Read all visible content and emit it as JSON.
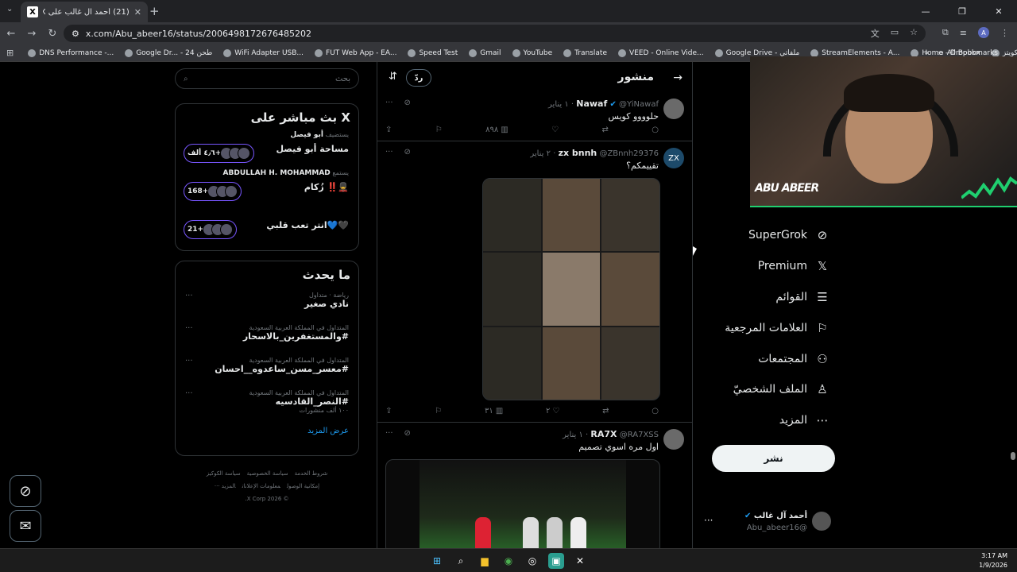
{
  "browser": {
    "tab_title": "(21) أحمد آل غالب على X: \"الي...",
    "tab_favicon": "X",
    "url": "x.com/Abu_abeer16/status/2006498172676485202",
    "bookmarks": [
      {
        "label": "DNS Performance -..."
      },
      {
        "label": "Google Dr... - طحن 24"
      },
      {
        "label": "WiFi Adapter USB..."
      },
      {
        "label": "FUT Web App - EA..."
      },
      {
        "label": "Speed Test"
      },
      {
        "label": "Gmail"
      },
      {
        "label": "YouTube"
      },
      {
        "label": "Translate"
      },
      {
        "label": "VEED - Online Vide..."
      },
      {
        "label": "Google Drive - ملفاتي"
      },
      {
        "label": "StreamElements - A..."
      },
      {
        "label": "Home - Dropbox"
      },
      {
        "label": "متجر الكويتز"
      }
    ],
    "all_bookmarks": "All Bookmarks",
    "profile_initial": "A"
  },
  "right": {
    "search_placeholder": "بحث",
    "live_title": "X بث مباشر على",
    "live": [
      {
        "host_label": "يستضيف",
        "host": "أبو فيصل",
        "name": "مساحة أبو فيصل",
        "count": "٤٫٦ ألف+"
      },
      {
        "host_label": "يستمع",
        "host": "ABDULLAH H. MOHAMMAD",
        "name": "💂‼️ زُكام",
        "count": "168+"
      },
      {
        "host_label": "",
        "host": "",
        "name": "🖤💙انتر تعب قلبي",
        "count": "21+"
      }
    ],
    "trends_title": "ما يحدث",
    "trends": [
      {
        "meta": "رياضة · متداول",
        "name": "نادي صغير",
        "extra": ""
      },
      {
        "meta": "المتداول في المملكة العربية السعودية",
        "name": "#والمستغفرين_بالاسحار",
        "extra": ""
      },
      {
        "meta": "المتداول في المملكة العربية السعودية",
        "name": "#معسر_مسن_ساعدوه__احسان",
        "extra": ""
      },
      {
        "meta": "المتداول في المملكة العربية السعودية",
        "name": "#النصر_القادسيه",
        "extra": "١٠٠ ألف منشورات"
      }
    ],
    "show_more": "عرض المزيد",
    "footer_line1": [
      "شروط الخدمة",
      "سياسة الخصوصية",
      "سياسة الكوكيز"
    ],
    "footer_line2": [
      "إمكانية الوصول",
      "معلومات الإعلانات",
      "المزيد ···"
    ],
    "footer_copy": "© 2026 X Corp."
  },
  "main": {
    "title": "منشور",
    "reply_label": "ردّ",
    "tweets": [
      {
        "avatar": "",
        "name": "Nawaf",
        "verified": true,
        "handle": "@YiNawaf",
        "date": "١ يناير",
        "text": "حلوووو كويس",
        "views": "٨٩٨",
        "likes": "",
        "has_media": "none"
      },
      {
        "avatar": "ZX",
        "name": "zx bnnh",
        "verified": false,
        "handle": "@ZBnnh29376",
        "date": "٢ يناير",
        "text": "تقييمكم؟",
        "views": "٣١",
        "likes": "٢",
        "has_media": "collage"
      },
      {
        "avatar": "",
        "name": "RA7X",
        "verified": false,
        "handle": "@RA7XSS",
        "date": "١ يناير",
        "text": "اول مره اسوي تصميم",
        "views": "",
        "likes": "",
        "has_media": "video"
      }
    ]
  },
  "left": {
    "nav": [
      {
        "label": "SuperGrok",
        "icon": "grok-icon",
        "glyph": "⊘"
      },
      {
        "label": "Premium",
        "icon": "x-logo-icon",
        "glyph": "𝕏"
      },
      {
        "label": "القوائم",
        "icon": "list-icon",
        "glyph": "☰"
      },
      {
        "label": "العلامات المرجعية",
        "icon": "bookmark-icon",
        "glyph": "⚐"
      },
      {
        "label": "المجتمعات",
        "icon": "communities-icon",
        "glyph": "⚇"
      },
      {
        "label": "الملف الشخصيّ",
        "icon": "profile-icon",
        "glyph": "♙"
      },
      {
        "label": "المزيد",
        "icon": "more-icon",
        "glyph": "⋯"
      }
    ],
    "post_label": "نشر",
    "account_name": "أحمد آل غالب",
    "account_handle": "@Abu_abeer16",
    "webcam_logo": "ABU ABEER"
  },
  "taskbar": {
    "time": "3:17 AM",
    "date": "1/9/2026"
  },
  "colors": {
    "accent": "#1d9bf0",
    "live_border": "#7856ff",
    "webcam_bar": "#1fcf6f"
  }
}
